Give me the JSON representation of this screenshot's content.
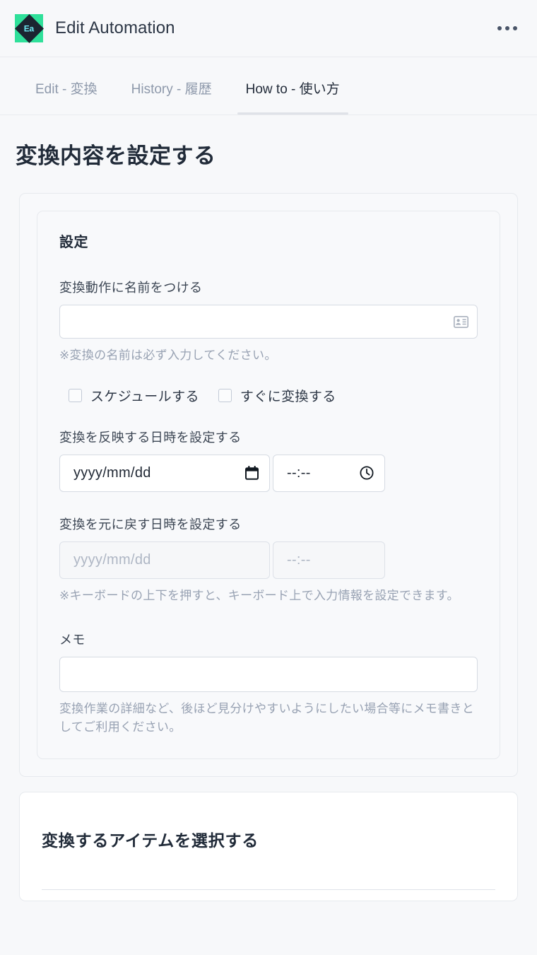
{
  "header": {
    "app_title": "Edit Automation",
    "logo_text": "Ea",
    "logo_bg": "#2fe09a",
    "menu_icon": "kebab-menu-icon"
  },
  "tabs": [
    {
      "label": "Edit - 変換",
      "active": false
    },
    {
      "label": "History - 履歴",
      "active": false
    },
    {
      "label": "How to - 使い方",
      "active": true
    }
  ],
  "page_title": "変換内容を設定する",
  "settings_section": {
    "title": "設定",
    "name_field": {
      "label": "変換動作に名前をつける",
      "value": "",
      "icon": "contact-card-icon",
      "hint": "※変換の名前は必ず入力してください。"
    },
    "checkboxes": [
      {
        "label": "スケジュールする",
        "checked": false
      },
      {
        "label": "すぐに変換する",
        "checked": false
      }
    ],
    "apply_datetime": {
      "label": "変換を反映する日時を設定する",
      "date_value": "yyyy/mm/dd",
      "time_value": "--:--",
      "date_icon": "calendar-icon",
      "time_icon": "clock-icon",
      "disabled": false
    },
    "revert_datetime": {
      "label": "変換を元に戻す日時を設定する",
      "date_value": "yyyy/mm/dd",
      "time_value": "--:--",
      "disabled": true
    },
    "keyboard_hint": "※キーボードの上下を押すと、キーボード上で入力情報を設定できます。",
    "memo": {
      "label": "メモ",
      "value": "",
      "hint": "変換作業の詳細など、後ほど見分けやすいようにしたい場合等にメモ書きとしてご利用ください。"
    }
  },
  "items_section": {
    "title": "変換するアイテムを選択する"
  }
}
